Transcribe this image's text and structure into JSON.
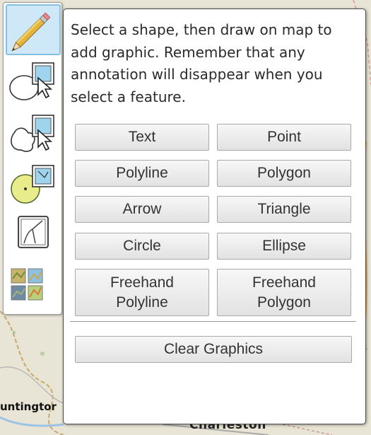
{
  "map": {
    "labels": {
      "huntington": "untingtor",
      "charleston": "Charleston",
      "edge_fragment": "s"
    }
  },
  "toolbar": {
    "tools": [
      {
        "name": "pencil-icon",
        "active": true
      },
      {
        "name": "select-by-circle-icon",
        "active": false
      },
      {
        "name": "select-by-freehand-icon",
        "active": false
      },
      {
        "name": "buffer-icon",
        "active": false
      },
      {
        "name": "clip-icon",
        "active": false
      },
      {
        "name": "basemap-gallery-icon",
        "active": false
      }
    ]
  },
  "panel": {
    "instructions": "Select a shape, then draw on map to add graphic. Remember that any annotation will disappear when you select a feature.",
    "buttons": {
      "text": "Text",
      "point": "Point",
      "polyline": "Polyline",
      "polygon": "Polygon",
      "arrow": "Arrow",
      "triangle": "Triangle",
      "circle": "Circle",
      "ellipse": "Ellipse",
      "freehand_polyline_line1": "Freehand",
      "freehand_polyline_line2": "Polyline",
      "freehand_polygon_line1": "Freehand",
      "freehand_polygon_line2": "Polygon",
      "clear_graphics": "Clear Graphics"
    }
  },
  "colors": {
    "panel_border": "#4a4a4a",
    "active_tool_bg": "#cfe8f7",
    "active_tool_border": "#87bfe3",
    "button_text": "#333333"
  }
}
